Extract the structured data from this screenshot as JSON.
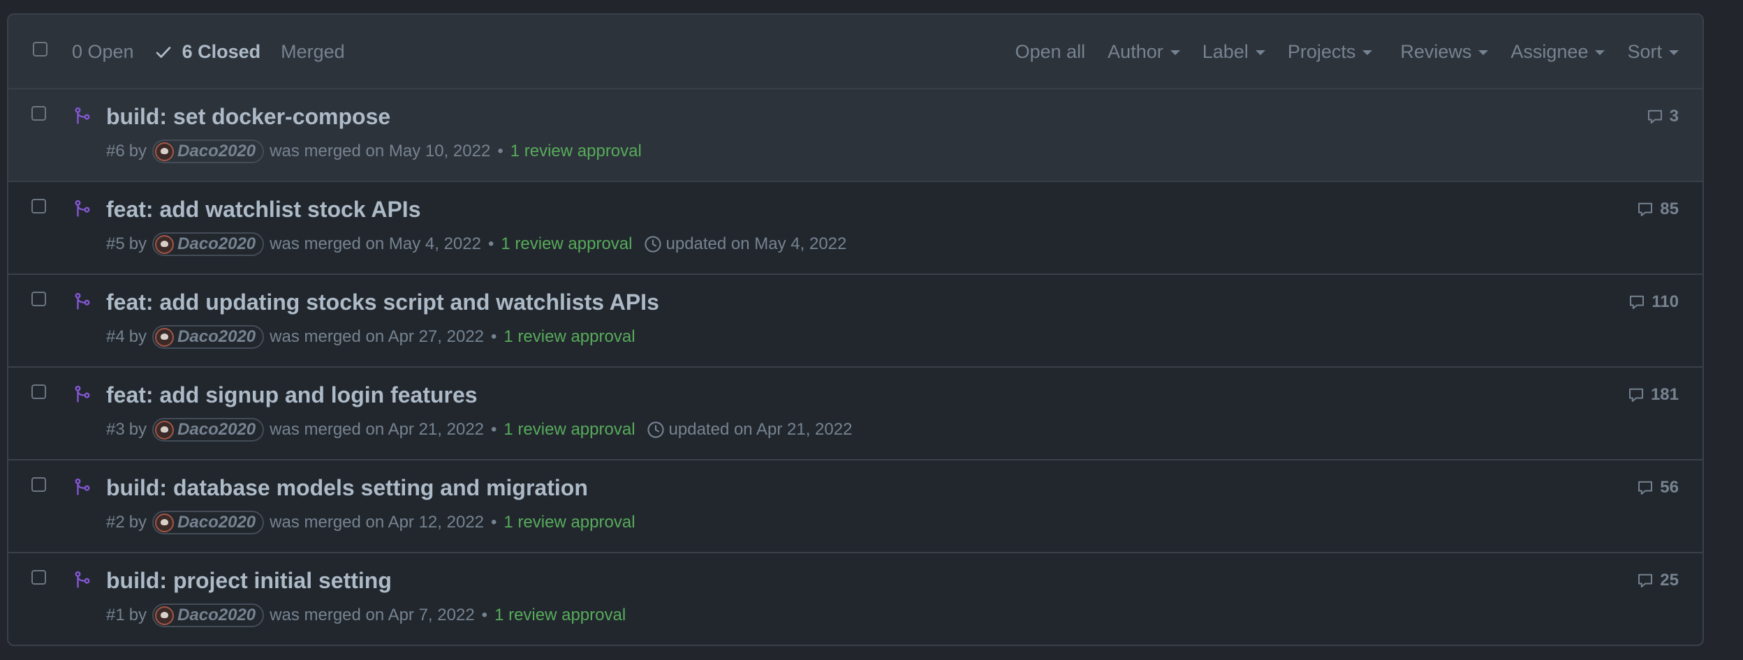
{
  "header": {
    "open_label": "0 Open",
    "closed_label": "6 Closed",
    "merged_label": "Merged",
    "filters": [
      "Open all",
      "Author",
      "Label",
      "Projects",
      "Reviews",
      "Assignee",
      "Sort"
    ]
  },
  "pulls": [
    {
      "title": "build: set docker-compose",
      "number": "#6",
      "by": "by",
      "author": "Daco2020",
      "merged_text": "was merged on May 10, 2022",
      "approval": "1 review approval",
      "updated": "",
      "comments": "3"
    },
    {
      "title": "feat: add watchlist stock APIs",
      "number": "#5",
      "by": "by",
      "author": "Daco2020",
      "merged_text": "was merged on May 4, 2022",
      "approval": "1 review approval",
      "updated": "updated on May 4, 2022",
      "comments": "85"
    },
    {
      "title": "feat: add updating stocks script and watchlists APIs",
      "number": "#4",
      "by": "by",
      "author": "Daco2020",
      "merged_text": "was merged on Apr 27, 2022",
      "approval": "1 review approval",
      "updated": "",
      "comments": "110"
    },
    {
      "title": "feat: add signup and login features",
      "number": "#3",
      "by": "by",
      "author": "Daco2020",
      "merged_text": "was merged on Apr 21, 2022",
      "approval": "1 review approval",
      "updated": "updated on Apr 21, 2022",
      "comments": "181"
    },
    {
      "title": "build: database models setting and migration",
      "number": "#2",
      "by": "by",
      "author": "Daco2020",
      "merged_text": "was merged on Apr 12, 2022",
      "approval": "1 review approval",
      "updated": "",
      "comments": "56"
    },
    {
      "title": "build: project initial setting",
      "number": "#1",
      "by": "by",
      "author": "Daco2020",
      "merged_text": "was merged on Apr 7, 2022",
      "approval": "1 review approval",
      "updated": "",
      "comments": "25"
    }
  ],
  "separator": "•",
  "icons": {
    "merged": "git-merge-icon",
    "comment": "comment-icon",
    "clock": "clock-icon",
    "check": "check-icon"
  },
  "colors": {
    "merged": "#8256d0",
    "approval": "#57ab5a",
    "background": "#22272e"
  }
}
